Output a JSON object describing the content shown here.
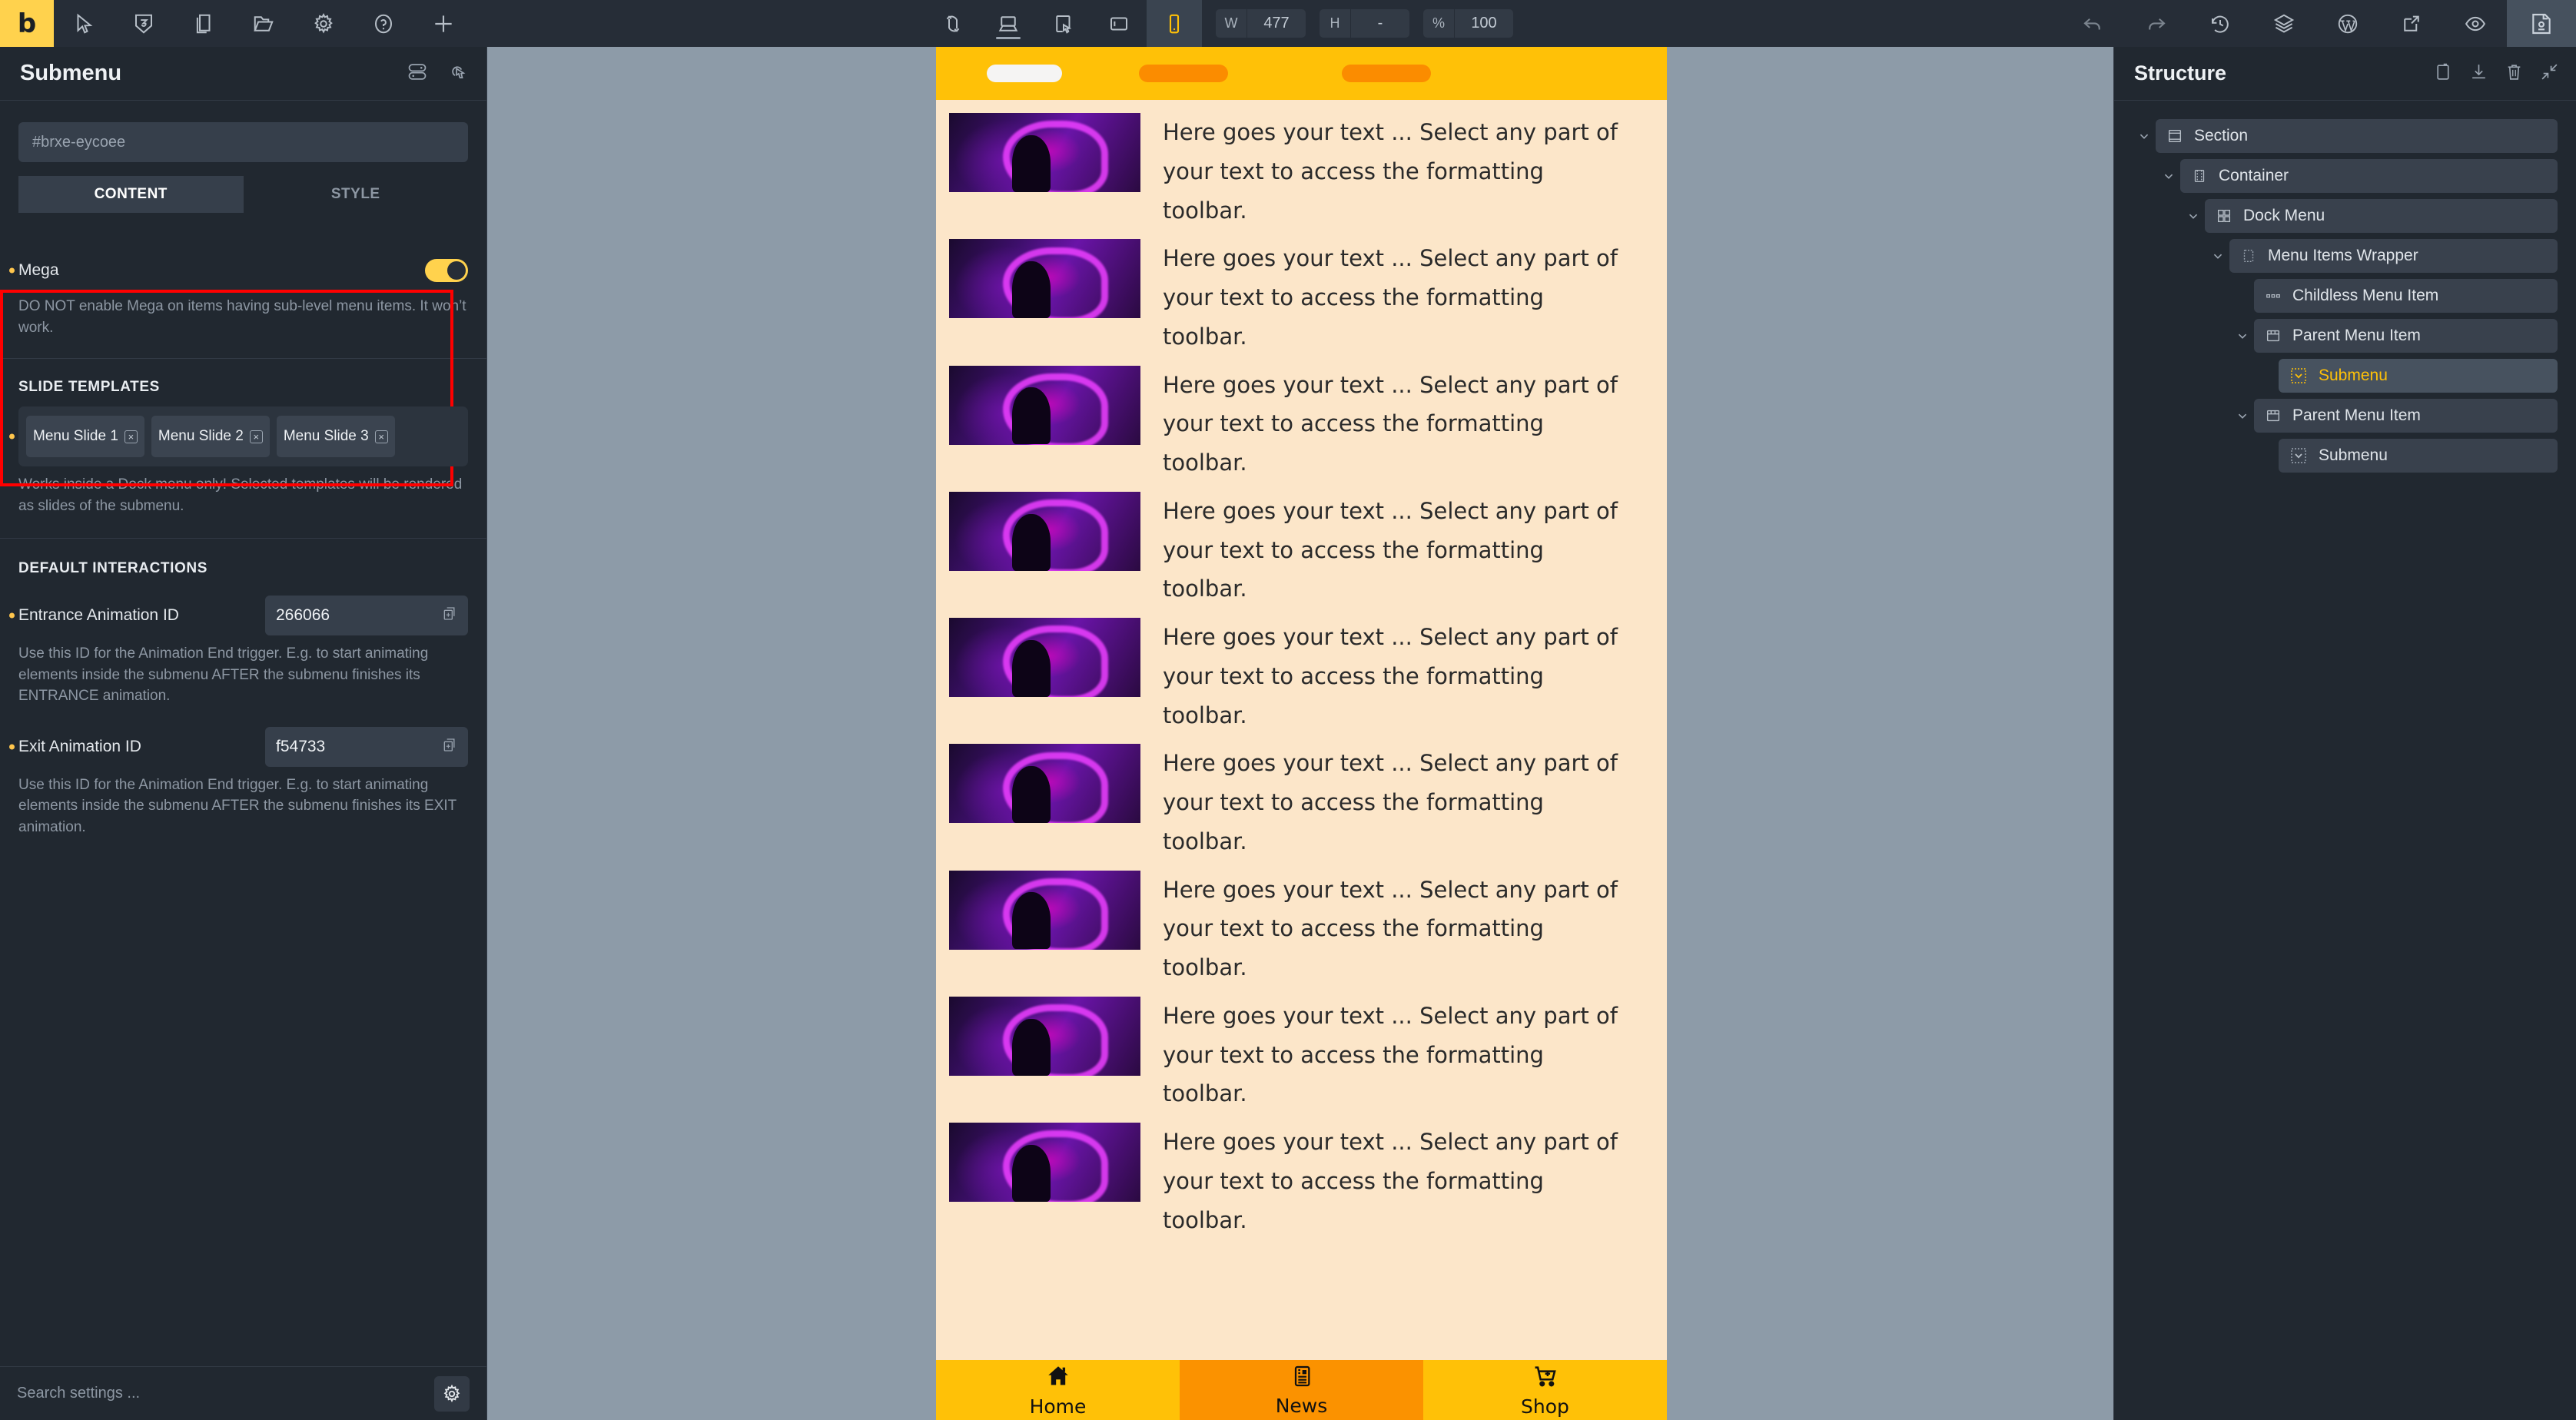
{
  "app": {
    "brand_letter": "b"
  },
  "toolbar": {
    "left_icons": [
      "cursor-icon",
      "css3-icon",
      "pages-icon",
      "folder-icon",
      "gear-icon",
      "help-icon",
      "plus-icon"
    ],
    "center_icons": [
      "revisions-icon",
      "desktop-icon",
      "tablet-icon",
      "landscape-icon",
      "mobile-icon"
    ],
    "width_label": "W",
    "width_value": "477",
    "height_label": "H",
    "height_value": "-",
    "zoom_label": "%",
    "zoom_value": "100",
    "right_icons": [
      "undo-icon",
      "redo-icon",
      "history-icon",
      "layers-icon",
      "wordpress-icon",
      "external-link-icon",
      "preview-eye-icon",
      "save-icon"
    ]
  },
  "left_panel": {
    "title": "Submenu",
    "id_placeholder": "#brxe-eycoee",
    "tabs": [
      {
        "label": "CONTENT",
        "active": true
      },
      {
        "label": "STYLE",
        "active": false
      }
    ],
    "mega": {
      "label": "Mega",
      "toggle_on": true,
      "help": "DO NOT enable Mega on items having sub-level menu items. It won’t work."
    },
    "slide_templates": {
      "title": "SLIDE TEMPLATES",
      "tags": [
        "Menu Slide 1",
        "Menu Slide 2",
        "Menu Slide 3"
      ],
      "help": "Works inside a Dock menu only! Selected templates will be rendered as slides of the submenu."
    },
    "default_interactions": {
      "title": "DEFAULT INTERACTIONS",
      "entrance": {
        "label": "Entrance Animation ID",
        "value": "266066",
        "help": "Use this ID for the Animation End trigger. E.g. to start animating elements inside the submenu AFTER the submenu finishes its ENTRANCE animation."
      },
      "exit": {
        "label": "Exit Animation ID",
        "value": "f54733",
        "help": "Use this ID for the Animation End trigger. E.g. to start animating elements inside the submenu AFTER the submenu finishes its EXIT animation."
      }
    },
    "footer": {
      "search_placeholder": "Search settings ...",
      "gear_icon": "gear-icon"
    }
  },
  "canvas": {
    "top_pills": [
      {
        "name": "pill-active",
        "color": "#f5f4f3"
      },
      {
        "name": "pill-2",
        "color": "#fb8c00"
      },
      {
        "name": "pill-3",
        "color": "#fb8c00"
      }
    ],
    "content_text": "Here goes your text ... Select any part of your text to access the formatting toolbar.",
    "content_rows": 9,
    "dock": [
      {
        "label": "Home",
        "icon": "home-icon",
        "active": false
      },
      {
        "label": "News",
        "icon": "news-icon",
        "active": true
      },
      {
        "label": "Shop",
        "icon": "cart-icon",
        "active": false
      }
    ]
  },
  "right_panel": {
    "title": "Structure",
    "header_icons": [
      "clipboard-icon",
      "download-icon",
      "trash-icon",
      "collapse-icon"
    ],
    "tree": [
      {
        "label": "Section",
        "icon": "section-icon",
        "depth": 0,
        "caret": true,
        "selected": false
      },
      {
        "label": "Container",
        "icon": "container-icon",
        "depth": 1,
        "caret": true,
        "selected": false
      },
      {
        "label": "Dock Menu",
        "icon": "grid-icon",
        "depth": 2,
        "caret": true,
        "selected": false
      },
      {
        "label": "Menu Items Wrapper",
        "icon": "dashed-box-icon",
        "depth": 3,
        "caret": true,
        "selected": false
      },
      {
        "label": "Childless Menu Item",
        "icon": "dots-icon",
        "depth": 4,
        "caret": false,
        "selected": false
      },
      {
        "label": "Parent Menu Item",
        "icon": "window-icon",
        "depth": 4,
        "caret": true,
        "selected": false
      },
      {
        "label": "Submenu",
        "icon": "submenu-icon",
        "depth": 5,
        "caret": false,
        "selected": true
      },
      {
        "label": "Parent Menu Item",
        "icon": "window-icon",
        "depth": 4,
        "caret": true,
        "selected": false
      },
      {
        "label": "Submenu",
        "icon": "submenu-icon",
        "depth": 5,
        "caret": false,
        "selected": false
      }
    ]
  },
  "colors": {
    "accent_yellow": "#ffc107",
    "panel_bg": "#212830",
    "toolbar_bg": "#262d37",
    "highlight_red": "#ff0000",
    "canvas_bg": "#8d9ba8",
    "device_bg": "#fce6c9",
    "dock_active": "#fb9200"
  }
}
